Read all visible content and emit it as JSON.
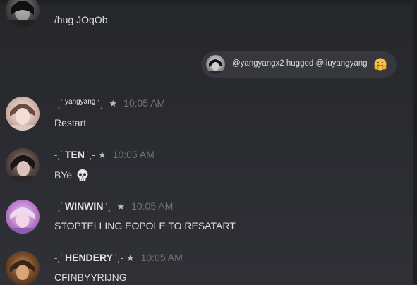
{
  "messages": [
    {
      "id": "m0",
      "text": "/hug JOqOb"
    },
    {
      "id": "m1",
      "deco_left": "-¸˙",
      "username": "yangyang",
      "deco_right": "ˊ¸-",
      "star": "★",
      "time": "10:05 AM",
      "text": "Restart"
    },
    {
      "id": "m2",
      "deco_left": "-¸˙",
      "username": "TEN",
      "deco_right": "ˊ¸-",
      "star": "★",
      "time": "10:05 AM",
      "text": "BYe"
    },
    {
      "id": "m3",
      "deco_left": "-¸˙",
      "username": "WINWIN",
      "deco_right": "ˊ¸-",
      "star": "★",
      "time": "10:05 AM",
      "text": "STOPTELLING EOPOLE TO RESATART"
    },
    {
      "id": "m4",
      "deco_left": "-¸˙",
      "username": "HENDERY",
      "deco_right": "ˊ¸-",
      "star": "★",
      "time": "10:05 AM",
      "text": "CFINBYYRIJNG"
    }
  ],
  "hug_event": {
    "text": "@yangyangx2 hugged @liuyangyang",
    "emoji": "hugging-face-emoji"
  },
  "icons": {
    "skull": "skull-emoji",
    "hug": "hugging-face-emoji"
  },
  "colors": {
    "background": "#2f3136",
    "text": "#dcddde",
    "timestamp": "#6f7277",
    "pill": "#36383d"
  }
}
